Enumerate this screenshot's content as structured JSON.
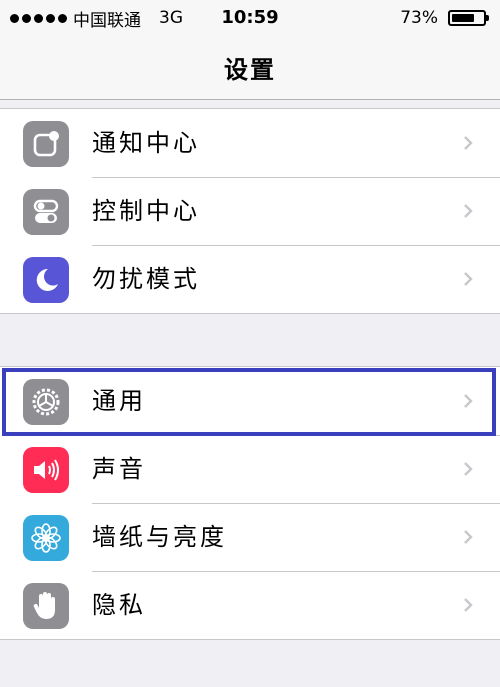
{
  "status_bar": {
    "carrier": "中国联通",
    "network": "3G",
    "time": "10:59",
    "battery_percent": "73%",
    "battery_level": 0.73
  },
  "nav": {
    "title": "设置"
  },
  "groups": [
    {
      "items": [
        {
          "label": "通知中心",
          "icon": "notification-center-icon",
          "icon_color": "#8e8e93"
        },
        {
          "label": "控制中心",
          "icon": "control-center-icon",
          "icon_color": "#8e8e93"
        },
        {
          "label": "勿扰模式",
          "icon": "moon-icon",
          "icon_color": "#5856d6"
        }
      ]
    },
    {
      "items": [
        {
          "label": "通用",
          "icon": "gear-icon",
          "icon_color": "#8e8e93",
          "highlighted": true
        },
        {
          "label": "声音",
          "icon": "speaker-icon",
          "icon_color": "#ff2d55"
        },
        {
          "label": "墙纸与亮度",
          "icon": "flower-icon",
          "icon_color": "#34aadc"
        },
        {
          "label": "隐私",
          "icon": "hand-icon",
          "icon_color": "#8e8e93"
        }
      ]
    }
  ],
  "colors": {
    "highlight_border": "#3a3fbd",
    "background": "#efeff4",
    "chevron": "#c7c7cc"
  }
}
